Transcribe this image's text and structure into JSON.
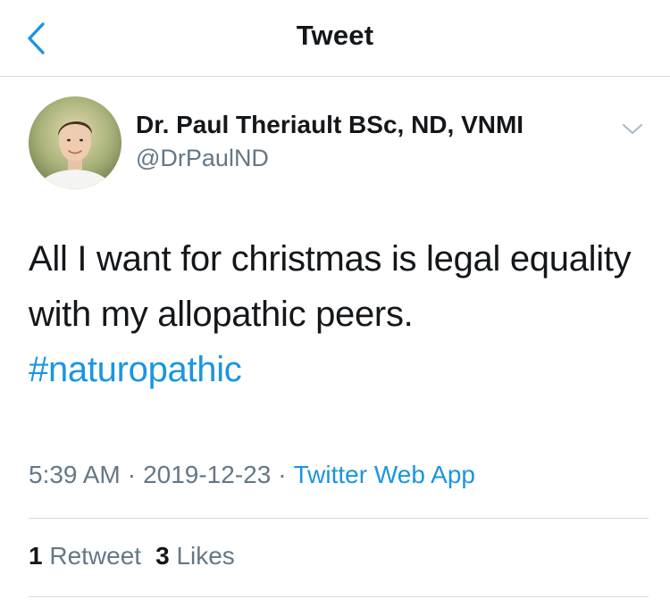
{
  "header": {
    "title": "Tweet",
    "back_icon": "chevron-left-icon"
  },
  "tweet": {
    "author": {
      "name": "Dr. Paul Theriault BSc, ND, VNMI",
      "handle": "@DrPaulND"
    },
    "text_lines": [
      "All I want for christmas is legal equality",
      "with my allopathic peers."
    ],
    "hashtag": "#naturopathic",
    "time": "5:39 AM",
    "date": "2019-12-23",
    "source": "Twitter Web App",
    "separator": "·",
    "retweets": {
      "count": "1",
      "label": "Retweet"
    },
    "likes": {
      "count": "3",
      "label": "Likes"
    }
  },
  "colors": {
    "link": "#1b95e0",
    "secondary_text": "#657786",
    "primary_text": "#14171a",
    "divider": "#d6d9dc"
  }
}
